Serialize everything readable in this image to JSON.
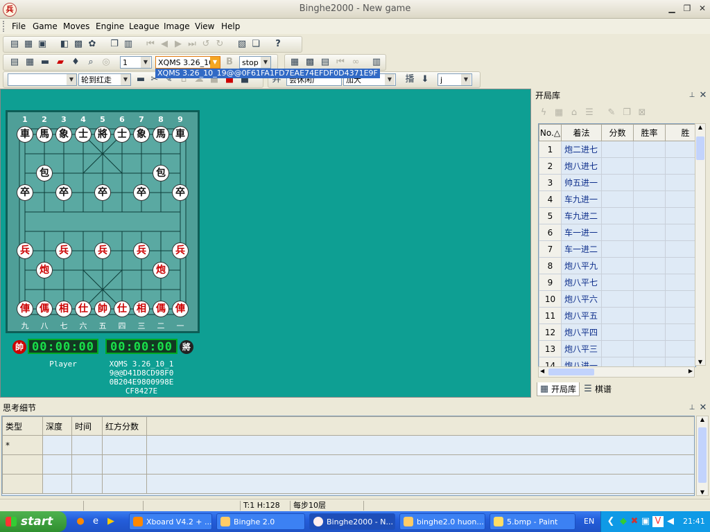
{
  "window": {
    "title": "Binghe2000 - New game",
    "app_icon_glyph": "兵"
  },
  "menu": [
    "File",
    "Game",
    "Moves",
    "Engine",
    "League",
    "Image",
    "View",
    "Help"
  ],
  "toolbar": {
    "depth_value": "1",
    "engine_value": "XQMS 3.26_10",
    "engine_tooltip": "XQMS 3.26_10_19@@0F61FA1FD7EAE74EFDF0D4371E9F",
    "stop_value": "stop",
    "turn_value": "轮到红走",
    "book_combo": "会休闲广",
    "level_combo": "加大",
    "j_value": "j"
  },
  "board": {
    "top_coords": [
      "1",
      "2",
      "3",
      "4",
      "5",
      "6",
      "7",
      "8",
      "9"
    ],
    "bottom_coords": [
      "九",
      "八",
      "七",
      "六",
      "五",
      "四",
      "三",
      "二",
      "一"
    ],
    "pieces": [
      {
        "c": "車",
        "side": "black",
        "col": 0,
        "row": 0
      },
      {
        "c": "馬",
        "side": "black",
        "col": 1,
        "row": 0
      },
      {
        "c": "象",
        "side": "black",
        "col": 2,
        "row": 0
      },
      {
        "c": "士",
        "side": "black",
        "col": 3,
        "row": 0
      },
      {
        "c": "將",
        "side": "black",
        "col": 4,
        "row": 0
      },
      {
        "c": "士",
        "side": "black",
        "col": 5,
        "row": 0
      },
      {
        "c": "象",
        "side": "black",
        "col": 6,
        "row": 0
      },
      {
        "c": "馬",
        "side": "black",
        "col": 7,
        "row": 0
      },
      {
        "c": "車",
        "side": "black",
        "col": 8,
        "row": 0
      },
      {
        "c": "包",
        "side": "black",
        "col": 1,
        "row": 2
      },
      {
        "c": "包",
        "side": "black",
        "col": 7,
        "row": 2
      },
      {
        "c": "卒",
        "side": "black",
        "col": 0,
        "row": 3
      },
      {
        "c": "卒",
        "side": "black",
        "col": 2,
        "row": 3
      },
      {
        "c": "卒",
        "side": "black",
        "col": 4,
        "row": 3
      },
      {
        "c": "卒",
        "side": "black",
        "col": 6,
        "row": 3
      },
      {
        "c": "卒",
        "side": "black",
        "col": 8,
        "row": 3
      },
      {
        "c": "兵",
        "side": "red",
        "col": 0,
        "row": 6
      },
      {
        "c": "兵",
        "side": "red",
        "col": 2,
        "row": 6
      },
      {
        "c": "兵",
        "side": "red",
        "col": 4,
        "row": 6
      },
      {
        "c": "兵",
        "side": "red",
        "col": 6,
        "row": 6
      },
      {
        "c": "兵",
        "side": "red",
        "col": 8,
        "row": 6
      },
      {
        "c": "炮",
        "side": "red",
        "col": 1,
        "row": 7
      },
      {
        "c": "炮",
        "side": "red",
        "col": 7,
        "row": 7
      },
      {
        "c": "俥",
        "side": "red",
        "col": 0,
        "row": 9
      },
      {
        "c": "傌",
        "side": "red",
        "col": 1,
        "row": 9
      },
      {
        "c": "相",
        "side": "red",
        "col": 2,
        "row": 9
      },
      {
        "c": "仕",
        "side": "red",
        "col": 3,
        "row": 9
      },
      {
        "c": "帥",
        "side": "red",
        "col": 4,
        "row": 9
      },
      {
        "c": "仕",
        "side": "red",
        "col": 5,
        "row": 9
      },
      {
        "c": "相",
        "side": "red",
        "col": 6,
        "row": 9
      },
      {
        "c": "傌",
        "side": "red",
        "col": 7,
        "row": 9
      },
      {
        "c": "俥",
        "side": "red",
        "col": 8,
        "row": 9
      }
    ]
  },
  "clocks": {
    "red_badge": "帥",
    "black_badge": "將",
    "red_time": "00:00:00",
    "black_time": "00:00:00",
    "red_player": "Player",
    "black_player_lines": [
      "XQMS 3.26_10_1",
      "9@@D41D8CD98F0",
      "0B204E9800998E",
      "CF8427E"
    ]
  },
  "opening_book": {
    "title": "开局库",
    "columns": [
      "No.△",
      "着法",
      "分数",
      "胜率",
      "胜"
    ],
    "rows": [
      {
        "no": "1",
        "move": "炮二进七"
      },
      {
        "no": "2",
        "move": "炮八进七"
      },
      {
        "no": "3",
        "move": "帅五进一"
      },
      {
        "no": "4",
        "move": "车九进一"
      },
      {
        "no": "5",
        "move": "车九进二"
      },
      {
        "no": "6",
        "move": "车一进一"
      },
      {
        "no": "7",
        "move": "车一进二"
      },
      {
        "no": "8",
        "move": "炮八平九"
      },
      {
        "no": "9",
        "move": "炮八平七"
      },
      {
        "no": "10",
        "move": "炮八平六"
      },
      {
        "no": "11",
        "move": "炮八平五"
      },
      {
        "no": "12",
        "move": "炮八平四"
      },
      {
        "no": "13",
        "move": "炮八平三"
      },
      {
        "no": "14",
        "move": "炮八进一"
      }
    ],
    "tabs": [
      "开局库",
      "棋谱"
    ]
  },
  "thinking": {
    "title": "思考细节",
    "columns": [
      "类型",
      "深度",
      "时间",
      "红方分数"
    ],
    "first_row_marker": "*"
  },
  "status": {
    "seg1": "",
    "seg2": "",
    "seg3": "T:1 H:128",
    "seg4": "每步10层"
  },
  "taskbar": {
    "start": "start",
    "buttons": [
      "Xboard V4.2 + ...",
      "Binghe 2.0",
      "Binghe2000 - N...",
      "binghe2.0 huon...",
      "5.bmp - Paint"
    ],
    "lang": "EN",
    "clock": "21:41"
  },
  "colors": {
    "board_area": "#0e9f93",
    "red_piece": "#cc0000",
    "clock_digits": "#19e04a",
    "taskbar": "#245edb"
  }
}
